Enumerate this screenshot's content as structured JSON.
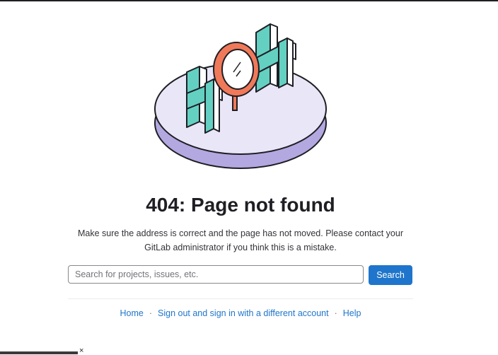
{
  "error": {
    "title": "404: Page not found",
    "description": "Make sure the address is correct and the page has not moved. Please contact your GitLab administrator if you think this is a mistake."
  },
  "search": {
    "placeholder": "Search for projects, issues, etc.",
    "value": "",
    "button_label": "Search"
  },
  "footer_links": {
    "home": "Home",
    "separator": "·",
    "sign_out": "Sign out and sign in with a different account",
    "help": "Help"
  },
  "bottom_bar": {
    "close_glyph": "×"
  },
  "colors": {
    "accent": "#1f75cb",
    "illustration_platform": "#e9e6f7",
    "illustration_shadow": "#b3a8e0",
    "illustration_digits": "#63d0c2",
    "illustration_magnifier": "#f0795a"
  }
}
